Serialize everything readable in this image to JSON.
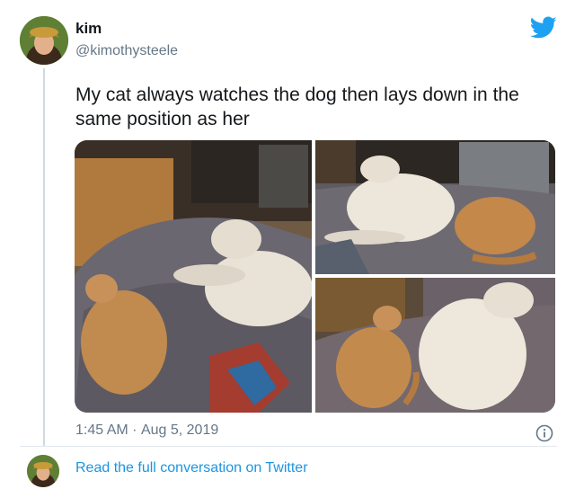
{
  "user": {
    "name": "kim",
    "handle": "@kimothysteele"
  },
  "tweet": {
    "text": "My cat always watches the dog then lays down in the same position as her",
    "time": "1:45 AM",
    "separator": "·",
    "date": "Aug 5, 2019"
  },
  "footer": {
    "link_label": "Read the full conversation on Twitter"
  },
  "icons": {
    "brand": "twitter-bird-icon",
    "info": "info-icon"
  },
  "colors": {
    "brand_blue": "#1da1f2",
    "link_blue": "#1b95e0",
    "muted_text": "#657786"
  }
}
